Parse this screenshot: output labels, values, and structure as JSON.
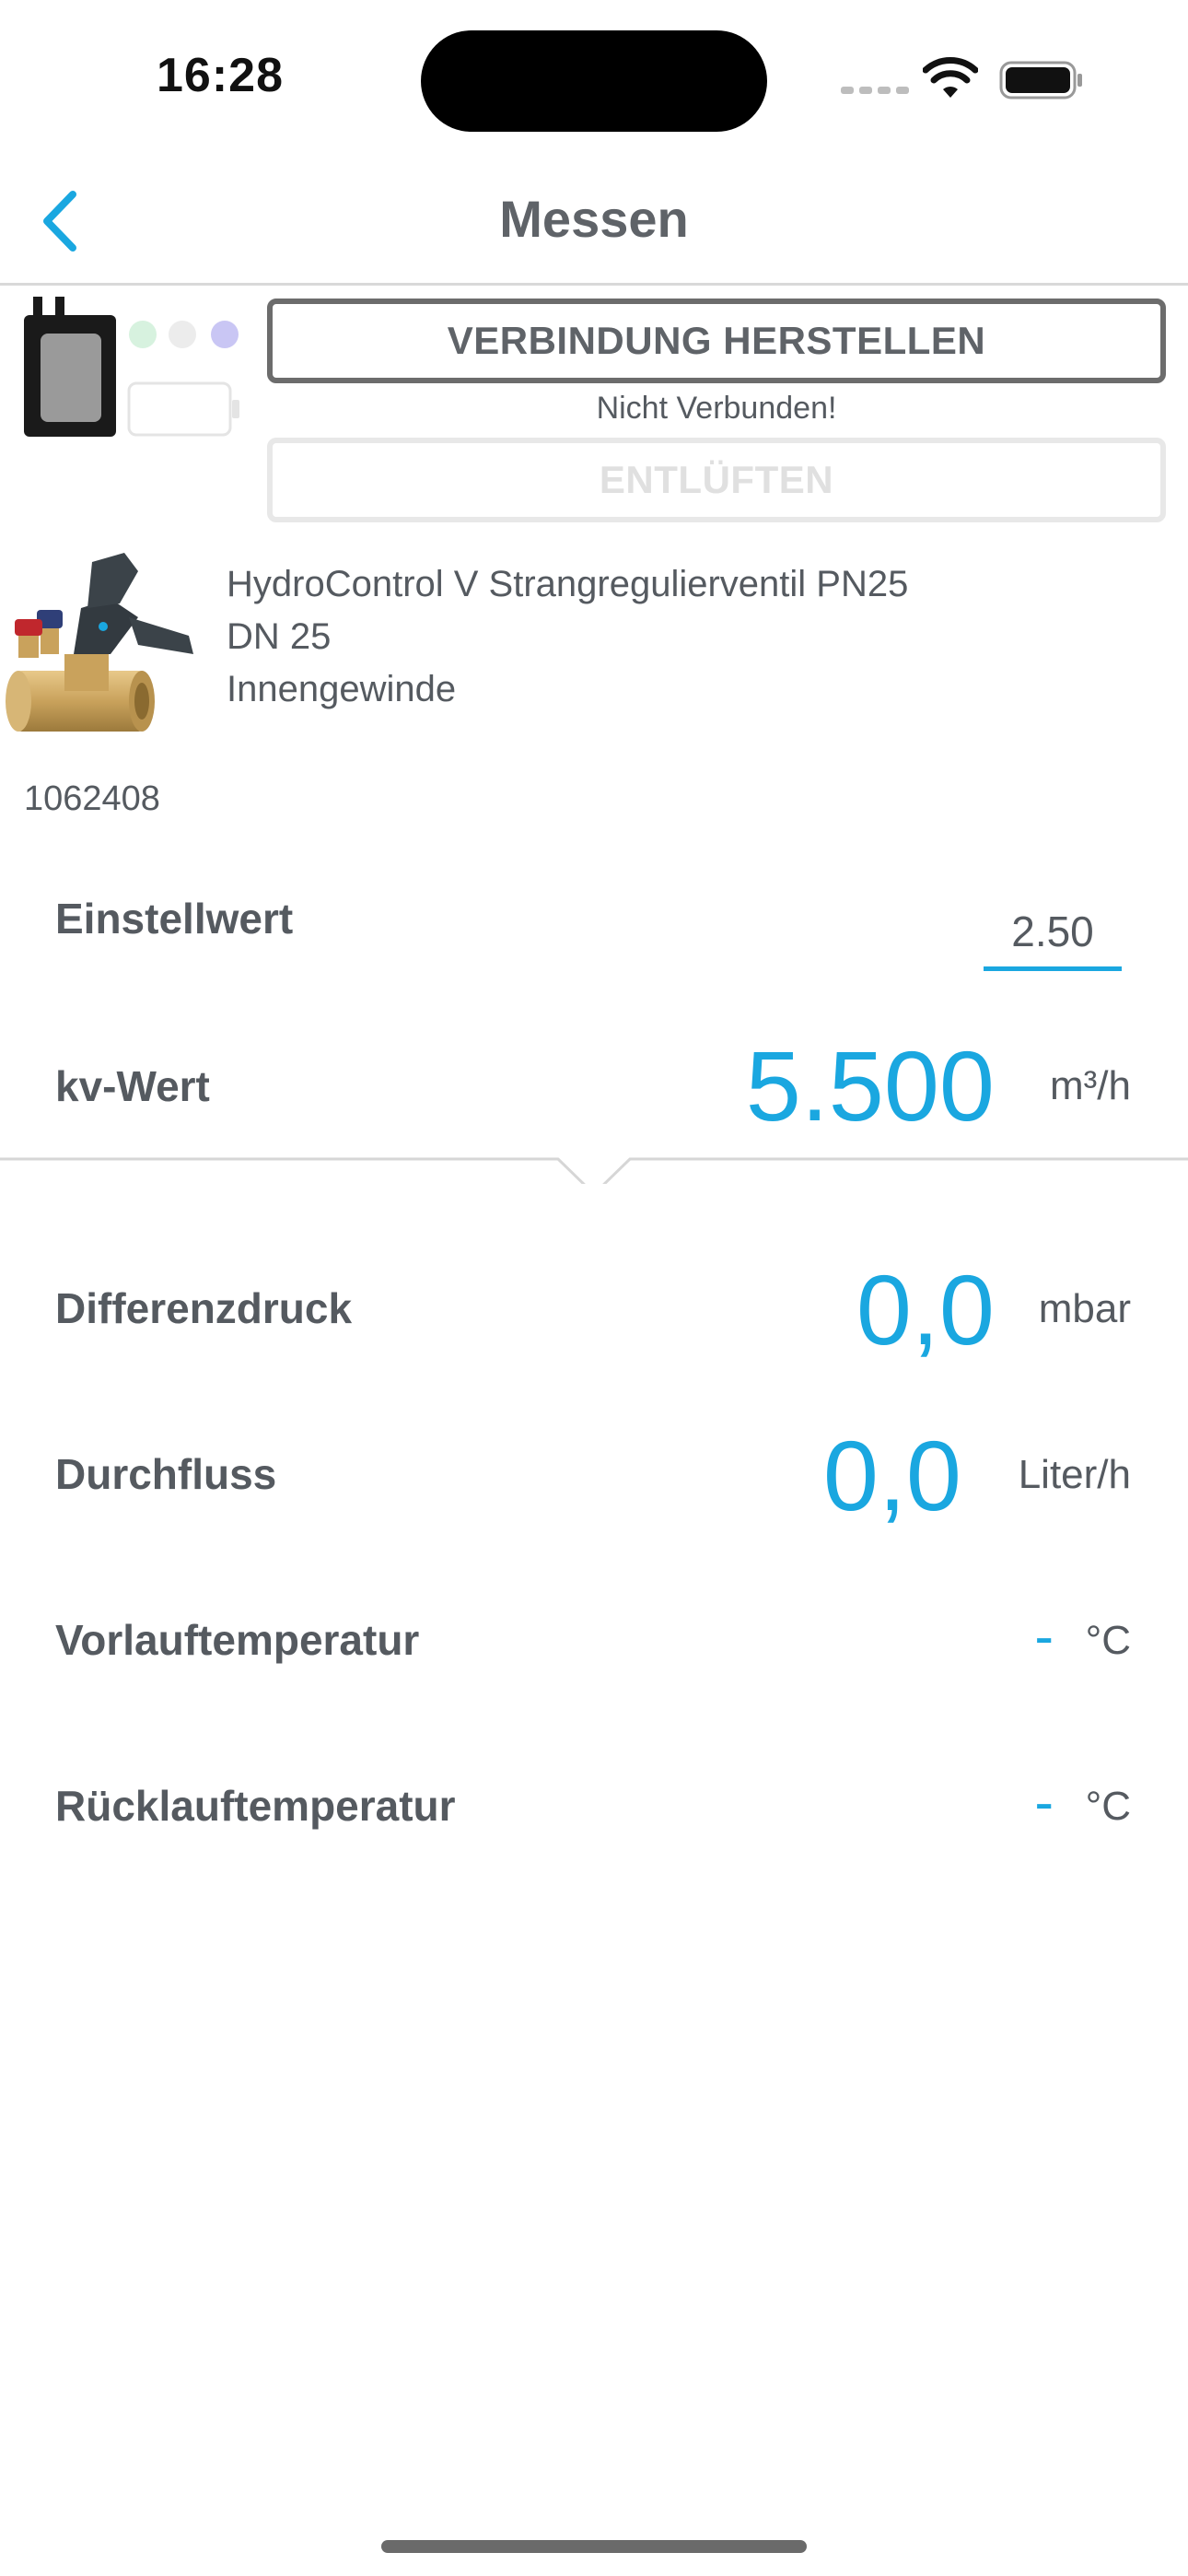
{
  "status_bar": {
    "time": "16:28"
  },
  "nav": {
    "title": "Messen",
    "back_icon": "chevron-left-icon"
  },
  "device": {
    "connect_label": "VERBINDUNG HERSTELLEN",
    "status_text": "Nicht Verbunden!",
    "vent_label": "ENTLÜFTEN",
    "indicator_colors": [
      "#d7f2df",
      "#ececec",
      "#c9c6f4"
    ]
  },
  "product": {
    "name": "HydroControl V Strangregulierventil PN25",
    "size": "DN 25",
    "thread": "Innengewinde",
    "number": "1062408"
  },
  "settings": {
    "einstellwert_label": "Einstellwert",
    "einstellwert_value": "2.50",
    "kv_label": "kv-Wert",
    "kv_value": "5.500",
    "kv_unit": "m³/h"
  },
  "measurements": [
    {
      "label": "Differenzdruck",
      "value": "0,0",
      "unit": "mbar"
    },
    {
      "label": "Durchfluss",
      "value": "0,0",
      "unit": "Liter/h"
    },
    {
      "label": "Vorlauftemperatur",
      "value": "-",
      "unit": "°C"
    },
    {
      "label": "Rücklauftemperatur",
      "value": "-",
      "unit": "°C"
    }
  ],
  "colors": {
    "accent": "#1aa7e0",
    "text": "#555a60",
    "title": "#5f6368"
  }
}
